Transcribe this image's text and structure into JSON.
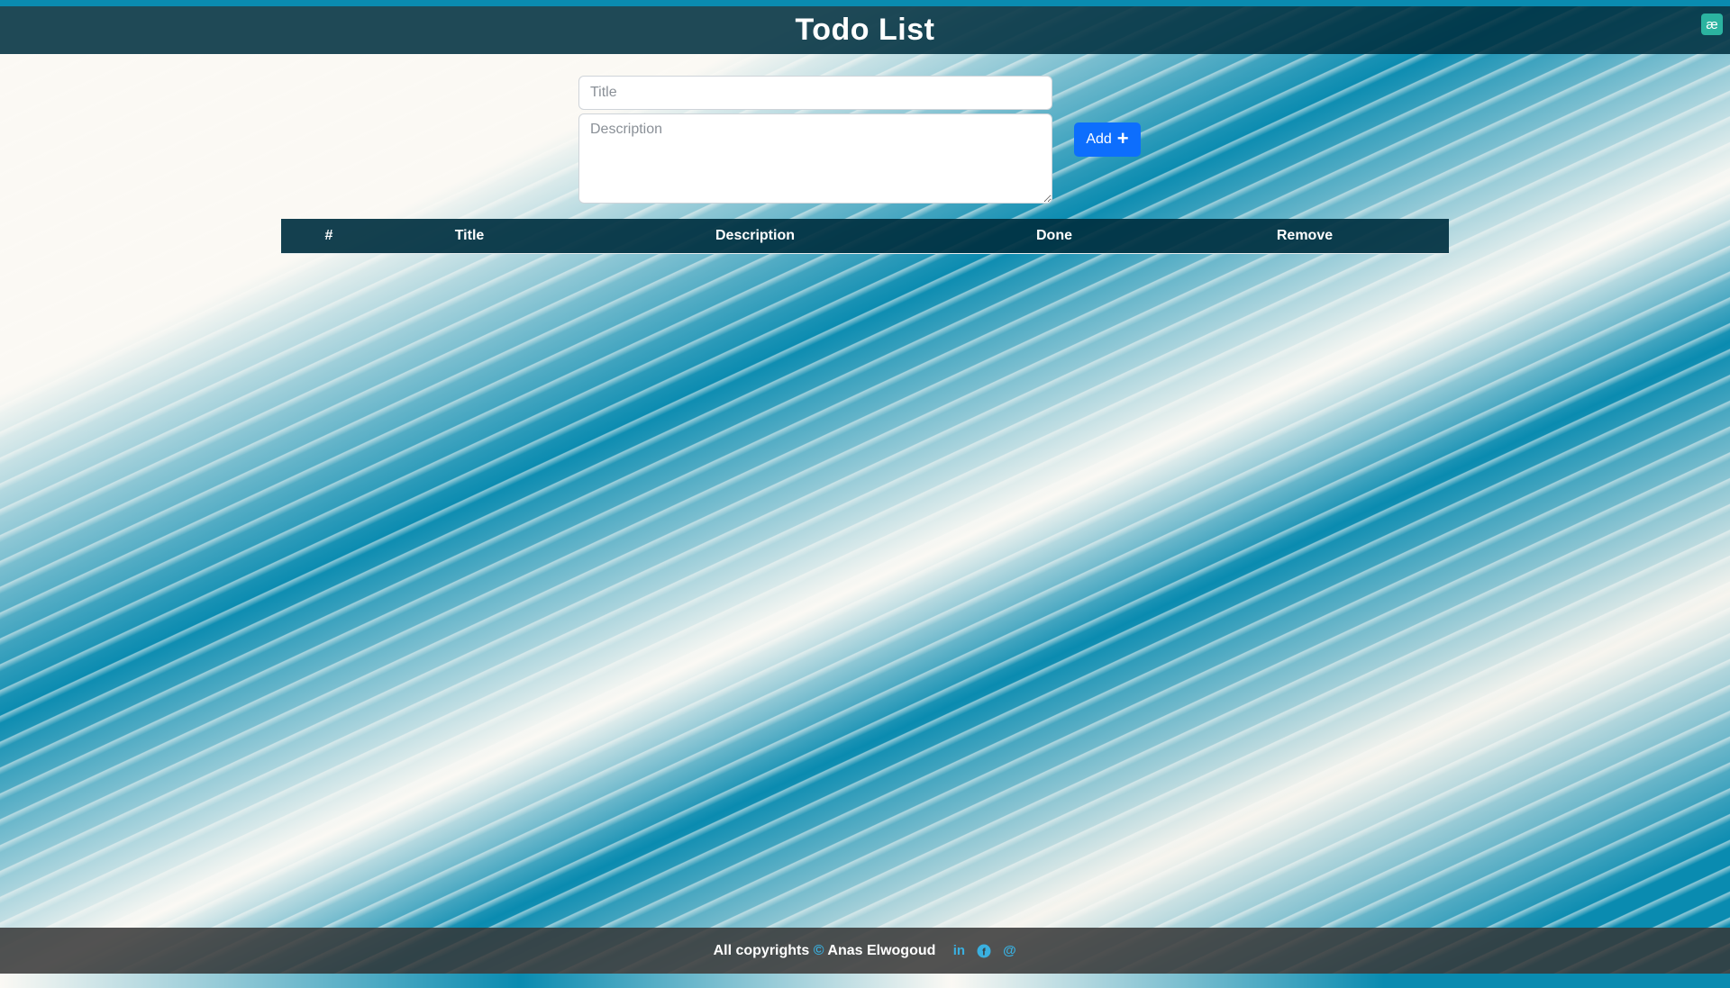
{
  "header": {
    "title": "Todo List",
    "badge": "æ"
  },
  "form": {
    "title_placeholder": "Title",
    "description_placeholder": "Description",
    "add_label": "Add",
    "add_icon": "+"
  },
  "table": {
    "columns": [
      "#",
      "Title",
      "Description",
      "Done",
      "Remove"
    ],
    "rows": []
  },
  "footer": {
    "prefix": "All copyrights",
    "copyright_symbol": "©",
    "author": "Anas Elwogoud",
    "icons": {
      "linkedin": "in",
      "facebook": "f",
      "email": "@"
    }
  },
  "colors": {
    "header_bg": "#003040",
    "accent_blue": "#0d6efd",
    "background_teal": "#0a8bb0",
    "footer_link": "#3ab0e0"
  }
}
